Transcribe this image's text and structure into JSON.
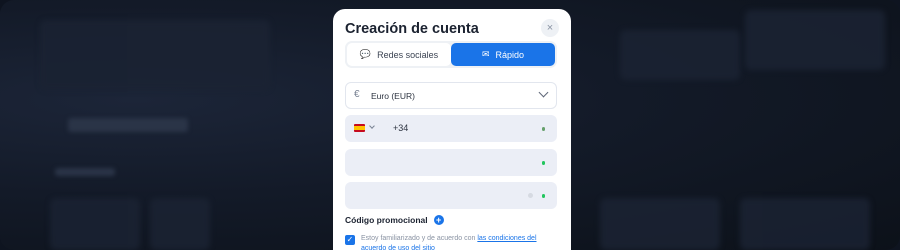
{
  "modal": {
    "title": "Creación de cuenta",
    "close_icon": "×"
  },
  "tabs": [
    {
      "label": "Redes sociales",
      "icon": "chat-bubbles-icon",
      "glyph": "💬",
      "active": false
    },
    {
      "label": "Rápido",
      "icon": "envelope-icon",
      "glyph": "✉",
      "active": true
    }
  ],
  "currency": {
    "icon": "euro-icon",
    "glyph": "€",
    "value": "Euro (EUR)"
  },
  "phone": {
    "country": "ES",
    "code": "+34"
  },
  "promo": {
    "label": "Código promocional",
    "plus": "+"
  },
  "terms": {
    "checked": true,
    "check_glyph": "✓",
    "prefix": "Estoy familiarizado y de acuerdo con",
    "link": "las condiciones del acuerdo de uso del sitio"
  },
  "colors": {
    "accent": "#1a74e8",
    "valid": "#22c55e",
    "backdrop": "#0e1420"
  }
}
